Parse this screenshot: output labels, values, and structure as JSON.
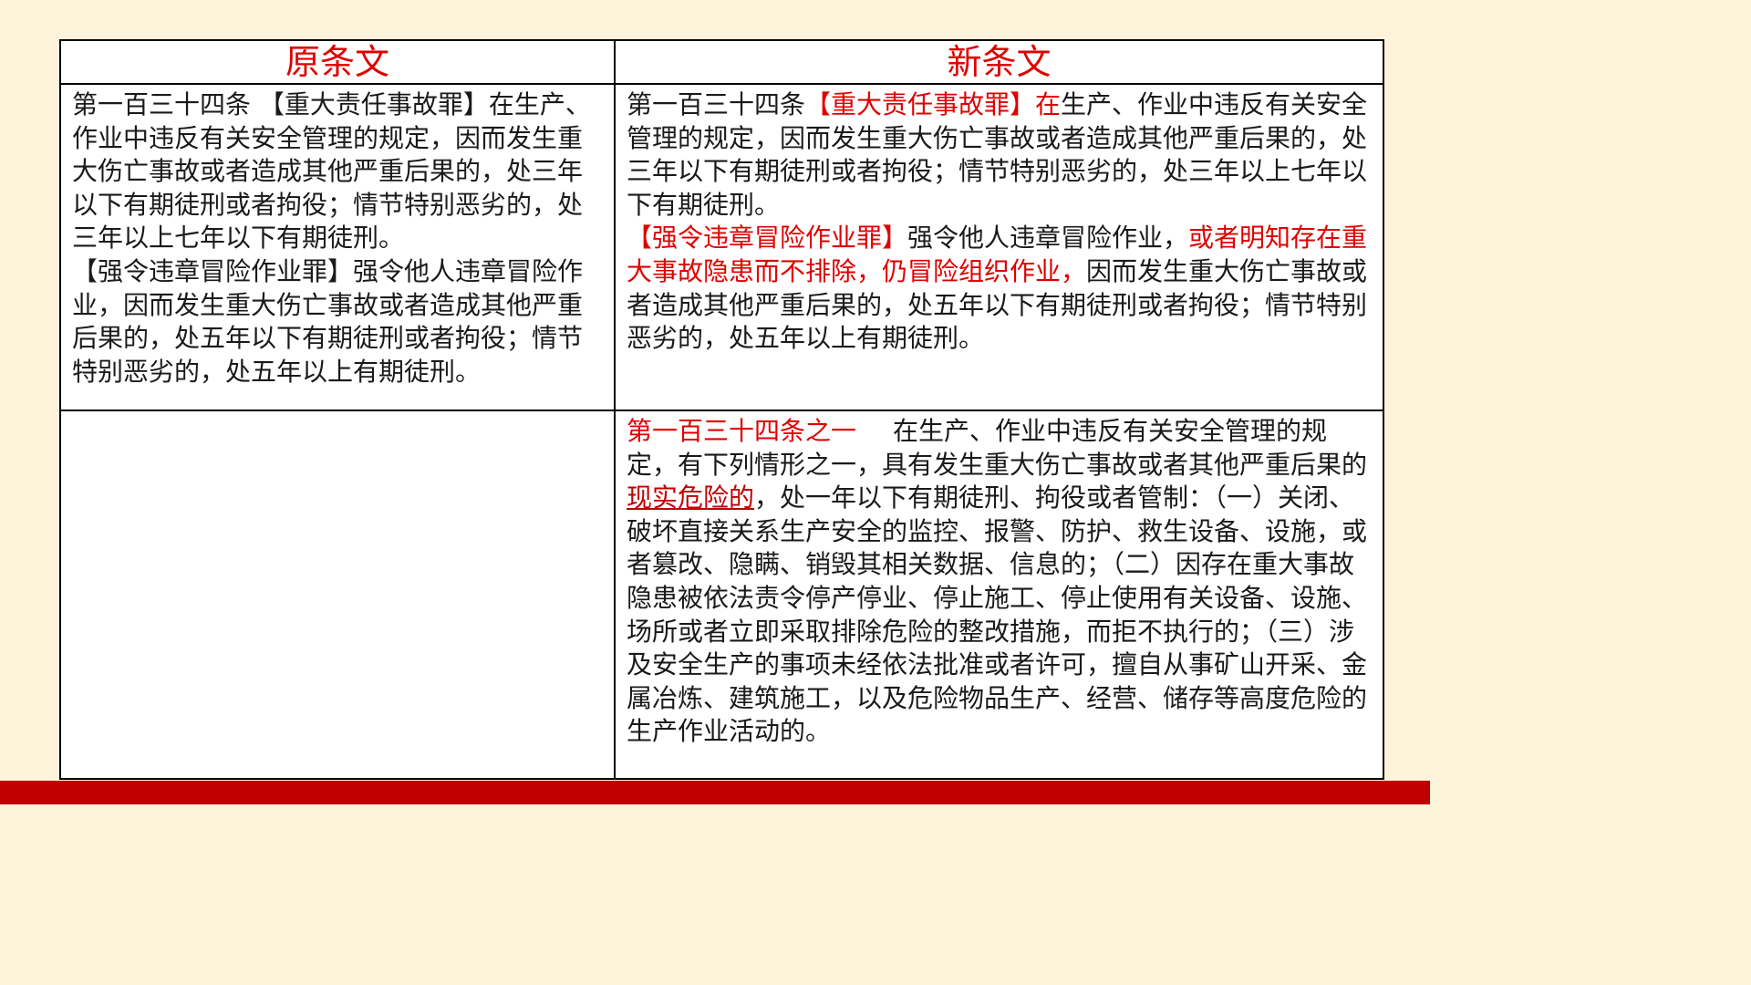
{
  "colors": {
    "accent_red": "#e00000",
    "bottom_bar": "#c00000",
    "background": "#fcf3da"
  },
  "table": {
    "headers": {
      "original": "原条文",
      "new": "新条文"
    },
    "row1": {
      "original": {
        "para1": "第一百三十四条 【重大责任事故罪】在生产、作业中违反有关安全管理的规定，因而发生重大伤亡事故或者造成其他严重后果的，处三年以下有期徒刑或者拘役；情节特别恶劣的，处三年以上七年以下有期徒刑。",
        "para2": "【强令违章冒险作业罪】强令他人违章冒险作业，因而发生重大伤亡事故或者造成其他严重后果的，处五年以下有期徒刑或者拘役；情节特别恶劣的，处五年以上有期徒刑。"
      },
      "new": {
        "p1_prefix": "第一百三十四条",
        "p1_red": "【重大责任事故罪】在",
        "p1_rest": "生产、作业中违反有关安全管理的规定，因而发生重大伤亡事故或者造成其他严重后果的，处三年以下有期徒刑或者拘役；情节特别恶劣的，处三年以上七年以下有期徒刑。",
        "p2_red1": "【强令违章冒险作业罪】",
        "p2_mid": "强令他人违章冒险作业，",
        "p2_red2": "或者明知存在重大事故隐患而不排除，仍冒险组织作业，",
        "p2_rest": "因而发生重大伤亡事故或者造成其他严重后果的，处五年以下有期徒刑或者拘役；情节特别恶劣的，处五年以上有期徒刑。"
      }
    },
    "row2": {
      "original": "",
      "new": {
        "red_title": "第一百三十四条之一",
        "text_a": "在生产、作业中违反有关安全管理的规定，有下列情形之一，具有发生重大伤亡事故或者其他严重后果的",
        "underlined": "现实危险的",
        "text_b": "，处一年以下有期徒刑、拘役或者管制：（一）关闭、破坏直接关系生产安全的监控、报警、防护、救生设备、设施，或者篡改、隐瞒、销毁其相关数据、信息的；（二）因存在重大事故隐患被依法责令停产停业、停止施工、停止使用有关设备、设施、场所或者立即采取排除危险的整改措施，而拒不执行的；（三）涉及安全生产的事项未经依法批准或者许可，擅自从事矿山开采、金属冶炼、建筑施工，以及危险物品生产、经营、储存等高度危险的生产作业活动的。"
      }
    }
  }
}
